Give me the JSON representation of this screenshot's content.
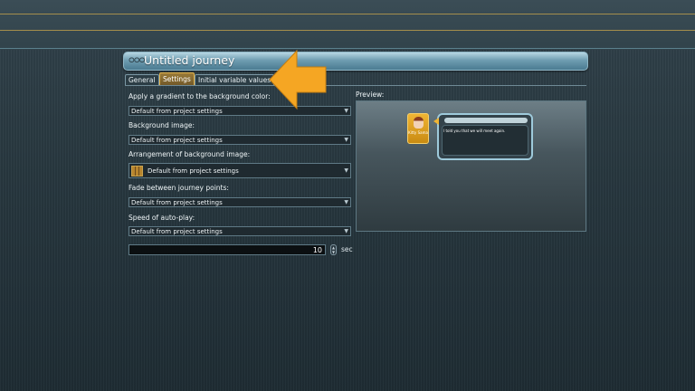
{
  "window": {
    "title": "Untitled journey",
    "title_icon": "journey-icon"
  },
  "tabs": [
    {
      "label": "General",
      "active": false
    },
    {
      "label": "Settings",
      "active": true
    },
    {
      "label": "Initial variable values",
      "active": false
    }
  ],
  "settings": {
    "gradient": {
      "label": "Apply a gradient to the background color:",
      "value": "Default from project settings"
    },
    "background_image": {
      "label": "Background image:",
      "value": "Default from project settings"
    },
    "arrangement": {
      "label": "Arrangement of background image:",
      "value": "Default from project settings"
    },
    "fade": {
      "label": "Fade between journey points:",
      "value": "Default from project settings"
    },
    "autoplay_speed": {
      "label": "Speed of auto-play:",
      "value": "Default from project settings"
    },
    "duration": {
      "value": "10",
      "unit": "sec"
    }
  },
  "preview": {
    "label": "Preview:",
    "character_name": "Kitty Sama",
    "dialog_text": "I told you that we will meet again."
  },
  "colors": {
    "accent_orange": "#f5a623",
    "tab_active": "#e3b24a",
    "title_bar": "#6f9db1"
  }
}
